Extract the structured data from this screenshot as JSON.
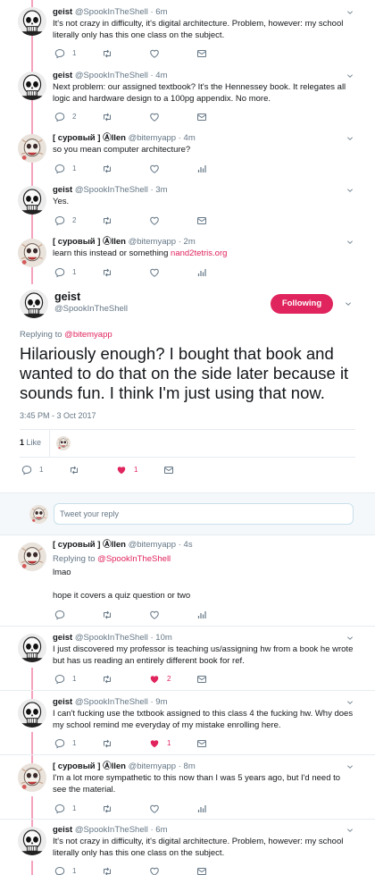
{
  "top_tweets": [
    {
      "name": "geist",
      "handle": "@SpookInTheShell",
      "time": "6m",
      "text": "It's not crazy in difficulty, it's digital architecture. Problem, however: my school literally only has this one class on the subject.",
      "reply_count": "1",
      "retweet_count": "",
      "like_count": "",
      "liked": false,
      "last_action": "mail-icon",
      "avatar": "skull"
    },
    {
      "name": "geist",
      "handle": "@SpookInTheShell",
      "time": "4m",
      "text": "Next problem: our assigned textbook? It's the Hennessey book. It relegates all logic and hardware design to a 100pg appendix. No more.",
      "reply_count": "2",
      "retweet_count": "",
      "like_count": "",
      "liked": false,
      "last_action": "mail-icon",
      "avatar": "skull"
    },
    {
      "name": "[ суровый ] Ⓐllen",
      "handle": "@bitemyapp",
      "time": "4m",
      "text": "so you mean computer architecture?",
      "reply_count": "1",
      "retweet_count": "",
      "like_count": "",
      "liked": false,
      "last_action": "analytics-icon",
      "avatar": "allen"
    },
    {
      "name": "geist",
      "handle": "@SpookInTheShell",
      "time": "3m",
      "text": "Yes.",
      "reply_count": "2",
      "retweet_count": "",
      "like_count": "",
      "liked": false,
      "last_action": "mail-icon",
      "avatar": "skull"
    },
    {
      "name": "[ суровый ] Ⓐllen",
      "handle": "@bitemyapp",
      "time": "2m",
      "text_before": "learn this instead or something ",
      "link": "nand2tetris.org",
      "reply_count": "1",
      "retweet_count": "",
      "like_count": "",
      "liked": false,
      "last_action": "analytics-icon",
      "avatar": "allen"
    }
  ],
  "main_tweet": {
    "name": "geist",
    "handle": "@SpookInTheShell",
    "follow_label": "Following",
    "replying_prefix": "Replying to ",
    "replying_to": "@bitemyapp",
    "text": "Hilariously enough? I bought that book and wanted to do that on the side later because it sounds fun. I think I'm just using that now.",
    "timestamp": "3:45 PM - 3 Oct 2017",
    "likes_count": "1",
    "likes_label": " Like",
    "reply_count": "1",
    "like_count": "1"
  },
  "reply_box": {
    "placeholder": "Tweet your reply"
  },
  "replies": [
    {
      "name": "[ суровый ] Ⓐllen",
      "handle": "@bitemyapp",
      "time": "4s",
      "replying_prefix": "Replying to ",
      "replying_to": "@SpookInTheShell",
      "text_line1": "lmao",
      "text_line2": "hope it covers a quiz question or two",
      "reply_count": "",
      "like_count": "",
      "liked": false,
      "last_action": "analytics-icon",
      "avatar": "allen"
    },
    {
      "name": "geist",
      "handle": "@SpookInTheShell",
      "time": "10m",
      "text": "I just discovered my professor is teaching us/assigning hw from a book he wrote but has us reading an entirely different book for ref.",
      "reply_count": "1",
      "like_count": "2",
      "liked": true,
      "last_action": "mail-icon",
      "avatar": "skull"
    },
    {
      "name": "geist",
      "handle": "@SpookInTheShell",
      "time": "9m",
      "text": "I can't fucking use the txtbook assigned to this class 4 the fucking hw. Why does my school remind me everyday of my mistake enrolling here.",
      "reply_count": "1",
      "like_count": "1",
      "liked": true,
      "last_action": "mail-icon",
      "avatar": "skull"
    },
    {
      "name": "[ суровый ] Ⓐllen",
      "handle": "@bitemyapp",
      "time": "8m",
      "text": "I'm a lot more sympathetic to this now than I was 5 years ago, but I'd need to see the material.",
      "reply_count": "1",
      "like_count": "",
      "liked": false,
      "last_action": "analytics-icon",
      "avatar": "allen"
    },
    {
      "name": "geist",
      "handle": "@SpookInTheShell",
      "time": "6m",
      "text": "It's not crazy in difficulty, it's digital architecture. Problem, however: my school literally only has this one class on the subject.",
      "reply_count": "1",
      "like_count": "",
      "liked": false,
      "last_action": "mail-icon",
      "avatar": "skull"
    }
  ],
  "colors": {
    "accent": "#e0245e",
    "thread_line": "#f5a3bd",
    "muted": "#657786",
    "divider": "#e6ecf0"
  }
}
